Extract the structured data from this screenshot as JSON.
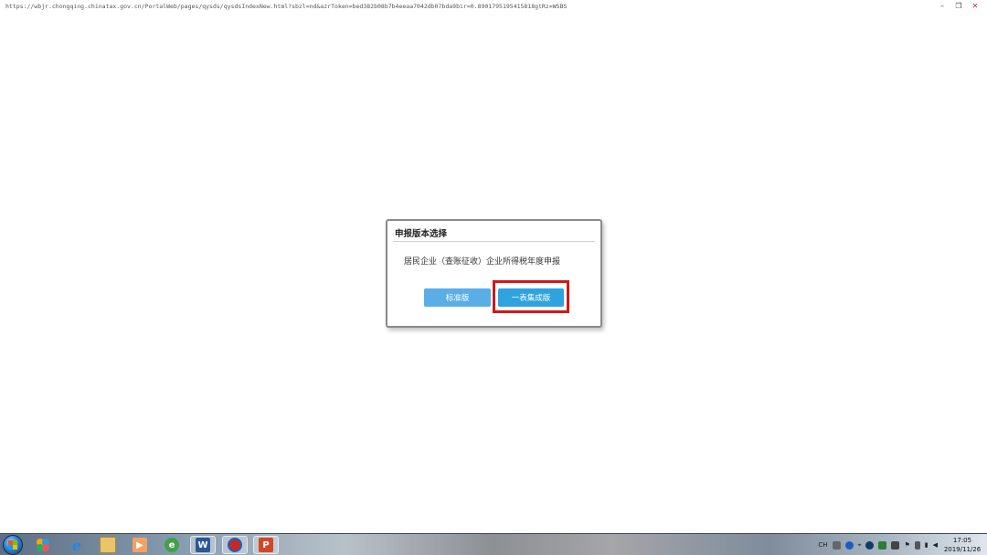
{
  "browser": {
    "url": "https://wbjr.chongqing.chinatax.gov.cn/PortalWeb/pages/qysds/qysdsIndexNew.html?sbzl=nd&azrToken=bed382b08b7b4eeaa7042db07bda9bir=0.8901795195415818gtRz=WSBS",
    "minimize_icon": "minimize-icon",
    "restore_icon": "restore-icon",
    "close_icon": "close-icon"
  },
  "dialog": {
    "title": "申报版本选择",
    "message": "居民企业（查账征收）企业所得税年度申报",
    "buttons": {
      "standard": "标准版",
      "one_table": "一表集成版"
    },
    "highlight_color": "#d01818"
  },
  "taskbar": {
    "start_icon": "windows-start-icon",
    "apps": [
      {
        "icon": "pinwheel-icon"
      },
      {
        "icon": "internet-explorer-icon"
      },
      {
        "icon": "file-explorer-icon"
      },
      {
        "icon": "media-player-icon"
      },
      {
        "icon": "browser-green-icon"
      },
      {
        "icon": "word-icon",
        "label": "W"
      },
      {
        "icon": "tax-client-icon"
      },
      {
        "icon": "powerpoint-icon",
        "label": "P"
      }
    ],
    "tray": {
      "language": "CH",
      "icons": [
        "keyboard-icon",
        "help-icon",
        "pin-icon",
        "network-globe-icon",
        "shield-icon",
        "printer-icon",
        "flag-icon",
        "battery-icon",
        "signal-icon",
        "volume-icon"
      ]
    },
    "clock": {
      "time": "17:05",
      "date": "2019/11/26"
    }
  }
}
